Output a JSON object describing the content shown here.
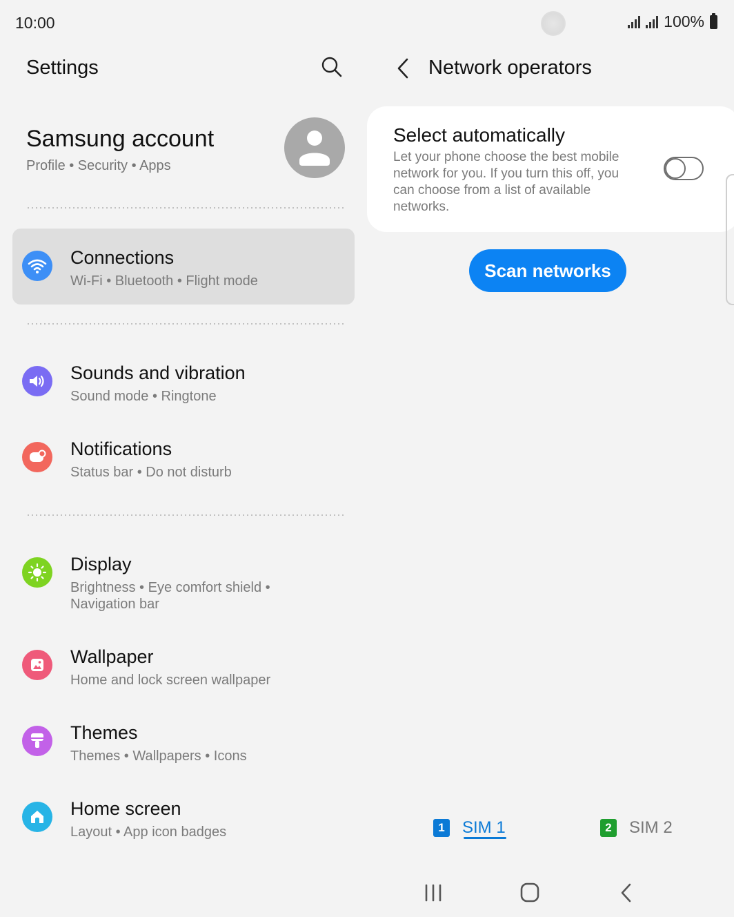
{
  "status": {
    "time": "10:00",
    "battery": "100%"
  },
  "settings": {
    "title": "Settings",
    "account": {
      "name": "Samsung account",
      "sub": "Profile  •  Security  •  Apps"
    },
    "items": [
      {
        "title": "Connections",
        "sub": "Wi-Fi  •  Bluetooth  •  Flight mode",
        "icon": "wifi-icon",
        "color": "#3d8ff6"
      },
      {
        "title": "Sounds and vibration",
        "sub": "Sound mode  •  Ringtone",
        "icon": "speaker-icon",
        "color": "#7a6cf3"
      },
      {
        "title": "Notifications",
        "sub": "Status bar  •  Do not disturb",
        "icon": "notification-icon",
        "color": "#f2675d"
      },
      {
        "title": "Display",
        "sub": "Brightness  •  Eye comfort shield  •  Navigation bar",
        "icon": "sun-icon",
        "color": "#7ed321"
      },
      {
        "title": "Wallpaper",
        "sub": "Home and lock screen wallpaper",
        "icon": "wallpaper-icon",
        "color": "#ef5a7a"
      },
      {
        "title": "Themes",
        "sub": "Themes  •  Wallpapers  •  Icons",
        "icon": "brush-icon",
        "color": "#c261e8"
      },
      {
        "title": "Home screen",
        "sub": "Layout  •  App icon badges",
        "icon": "home-icon",
        "color": "#27b4e6"
      }
    ]
  },
  "network": {
    "title": "Network operators",
    "select_auto": {
      "title": "Select automatically",
      "desc": "Let your phone choose the best mobile network for you. If you turn this off, you can choose from a list of available networks.",
      "enabled": false
    },
    "scan_label": "Scan networks",
    "sim_tabs": [
      {
        "badge": "1",
        "label": "SIM 1",
        "active": true,
        "color": "#0b7ad6"
      },
      {
        "badge": "2",
        "label": "SIM 2",
        "active": false,
        "color": "#1f9e2f"
      }
    ]
  },
  "colors": {
    "accent": "#0c83f3",
    "selected_row": "#dedede"
  }
}
